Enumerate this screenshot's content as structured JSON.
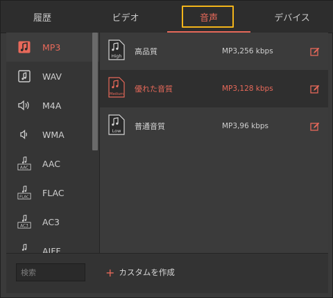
{
  "tabs": [
    {
      "label": "履歴",
      "active": false
    },
    {
      "label": "ビデオ",
      "active": false
    },
    {
      "label": "音声",
      "active": true
    },
    {
      "label": "デバイス",
      "active": false
    }
  ],
  "formats": [
    {
      "label": "MP3",
      "icon": "music-note-icon",
      "active": true
    },
    {
      "label": "WAV",
      "icon": "wav-file-icon",
      "active": false
    },
    {
      "label": "M4A",
      "icon": "speaker-icon",
      "active": false
    },
    {
      "label": "WMA",
      "icon": "wma-icon",
      "active": false
    },
    {
      "label": "AAC",
      "icon": "aac-file-icon",
      "active": false,
      "badge": "AAC"
    },
    {
      "label": "FLAC",
      "icon": "flac-file-icon",
      "active": false,
      "badge": "FLAC"
    },
    {
      "label": "AC3",
      "icon": "ac3-file-icon",
      "active": false,
      "badge": "AC3"
    },
    {
      "label": "AIFF",
      "icon": "aiff-file-icon",
      "active": false
    }
  ],
  "qualities": [
    {
      "name": "高品質",
      "spec": "MP3,256 kbps",
      "badge": "High",
      "active": false
    },
    {
      "name": "優れた音質",
      "spec": "MP3,128 kbps",
      "badge": "Medium",
      "active": true
    },
    {
      "name": "普通音質",
      "spec": "MP3,96 kbps",
      "badge": "Low",
      "active": false
    }
  ],
  "bottom": {
    "search_placeholder": "検索",
    "create_label": "カスタムを作成"
  },
  "colors": {
    "accent": "#e8695a",
    "highlight_box": "#f4b51a"
  }
}
